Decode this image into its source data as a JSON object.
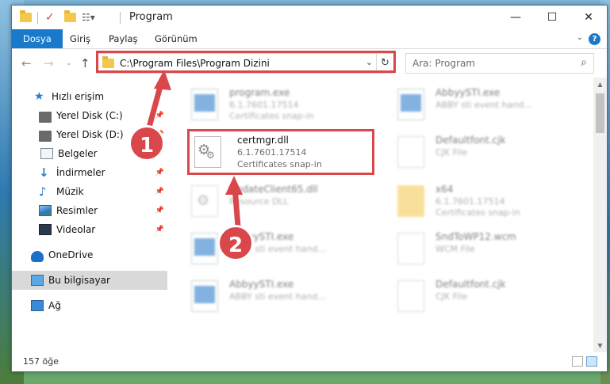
{
  "window": {
    "title": "Program",
    "controls": {
      "minimize": "—",
      "maximize": "☐",
      "close": "✕"
    }
  },
  "ribbon": {
    "tabs": [
      "Dosya",
      "Giriş",
      "Paylaş",
      "Görünüm"
    ],
    "help": "?"
  },
  "nav": {
    "address": "C:\\Program Files\\Program Dizini",
    "search_placeholder": "Ara: Program"
  },
  "sidebar": {
    "items": [
      {
        "label": "Hızlı erişim",
        "icon": "star-icon"
      },
      {
        "label": "Yerel Disk (C:)",
        "icon": "drive-icon",
        "pinned": true
      },
      {
        "label": "Yerel Disk (D:)",
        "icon": "drive-icon",
        "pinned": true
      },
      {
        "label": "Belgeler",
        "icon": "document-icon",
        "pinned": true
      },
      {
        "label": "İndirmeler",
        "icon": "download-icon",
        "pinned": true
      },
      {
        "label": "Müzik",
        "icon": "music-icon",
        "pinned": true
      },
      {
        "label": "Resimler",
        "icon": "pictures-icon",
        "pinned": true
      },
      {
        "label": "Videolar",
        "icon": "videos-icon",
        "pinned": true
      },
      {
        "label": "OneDrive",
        "icon": "cloud-icon"
      },
      {
        "label": "Bu bilgisayar",
        "icon": "computer-icon",
        "selected": true
      },
      {
        "label": "Ağ",
        "icon": "network-icon"
      }
    ]
  },
  "files": [
    {
      "name": "program.exe",
      "line1": "6.1.7601.17514",
      "line2": "Certificates snap-in",
      "icon": "exe-icon",
      "blurred": true
    },
    {
      "name": "AbbyySTI.exe",
      "line1": "ABBY sti event hand...",
      "line2": "",
      "icon": "exe-icon",
      "blurred": true
    },
    {
      "name": "certmgr.dll",
      "line1": "6.1.7601.17514",
      "line2": "Certificates snap-in",
      "icon": "gear-file-icon",
      "blurred": false
    },
    {
      "name": "Defaultfont.cjk",
      "line1": "CJK File",
      "line2": "",
      "icon": "file-icon",
      "blurred": true
    },
    {
      "name": "UpdateClient65.dll",
      "line1": "Resource DLL",
      "line2": "",
      "icon": "gear-file-icon",
      "blurred": true
    },
    {
      "name": "x64",
      "line1": "6.1.7601.17514",
      "line2": "Certificates snap-in",
      "icon": "folder-icon",
      "blurred": true
    },
    {
      "name": "AbbyySTI.exe",
      "line1": "ABBY sti event hand...",
      "line2": "",
      "icon": "exe-icon",
      "blurred": true
    },
    {
      "name": "SndToWP12.wcm",
      "line1": "WCM File",
      "line2": "",
      "icon": "file-icon",
      "blurred": true
    },
    {
      "name": "AbbyySTI.exe",
      "line1": "ABBY sti event hand...",
      "line2": "",
      "icon": "exe-icon",
      "blurred": true
    },
    {
      "name": "Defaultfont.cjk",
      "line1": "CJK File",
      "line2": "",
      "icon": "file-icon",
      "blurred": true
    }
  ],
  "status": {
    "count": "157 öğe"
  },
  "annotations": {
    "badge1": "1",
    "badge2": "2",
    "color": "#d9474b"
  }
}
